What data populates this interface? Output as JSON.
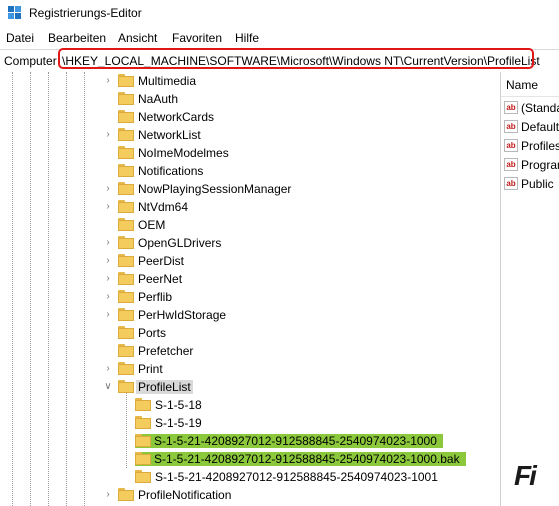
{
  "window": {
    "title": "Registrierungs-Editor",
    "icon": "registry-editor-icon"
  },
  "menu": [
    "Datei",
    "Bearbeiten",
    "Ansicht",
    "Favoriten",
    "Hilfe"
  ],
  "address": {
    "computer": "Computer",
    "path": "\\HKEY_LOCAL_MACHINE\\SOFTWARE\\Microsoft\\Windows NT\\CurrentVersion\\ProfileList",
    "highlight_color": "#e01818"
  },
  "tree": {
    "items": [
      {
        "label": "Multimedia",
        "expander": "collapsed"
      },
      {
        "label": "NaAuth",
        "expander": "none"
      },
      {
        "label": "NetworkCards",
        "expander": "none"
      },
      {
        "label": "NetworkList",
        "expander": "collapsed"
      },
      {
        "label": "NoImeModelmes",
        "expander": "none"
      },
      {
        "label": "Notifications",
        "expander": "none"
      },
      {
        "label": "NowPlayingSessionManager",
        "expander": "collapsed"
      },
      {
        "label": "NtVdm64",
        "expander": "collapsed"
      },
      {
        "label": "OEM",
        "expander": "none"
      },
      {
        "label": "OpenGLDrivers",
        "expander": "collapsed"
      },
      {
        "label": "PeerDist",
        "expander": "collapsed"
      },
      {
        "label": "PeerNet",
        "expander": "collapsed"
      },
      {
        "label": "Perflib",
        "expander": "collapsed"
      },
      {
        "label": "PerHwIdStorage",
        "expander": "collapsed"
      },
      {
        "label": "Ports",
        "expander": "none"
      },
      {
        "label": "Prefetcher",
        "expander": "none"
      },
      {
        "label": "Print",
        "expander": "collapsed"
      },
      {
        "label": "ProfileList",
        "expander": "expanded",
        "selected": true
      },
      {
        "label": "S-1-5-18",
        "child": true
      },
      {
        "label": "S-1-5-19",
        "child": true
      },
      {
        "label": "S-1-5-21-4208927012-912588845-2540974023-1000",
        "child": true,
        "highlight": true
      },
      {
        "label": "S-1-5-21-4208927012-912588845-2540974023-1000.bak",
        "child": true,
        "highlight": true
      },
      {
        "label": "S-1-5-21-4208927012-912588845-2540974023-1001",
        "child": true
      },
      {
        "label": "ProfileNotification",
        "expander": "collapsed"
      }
    ],
    "selected_bg": "#d9d9d9",
    "highlight_bg": "#8bc83c"
  },
  "values": {
    "column_name": "Name",
    "items": [
      {
        "label": "(Standard)",
        "icon": "string-value-icon"
      },
      {
        "label": "Default",
        "icon": "string-value-icon"
      },
      {
        "label": "ProfilesDirectory",
        "icon": "string-value-icon"
      },
      {
        "label": "ProgramData",
        "icon": "string-value-icon"
      },
      {
        "label": "Public",
        "icon": "string-value-icon"
      }
    ]
  },
  "watermark": {
    "text": "Fi"
  }
}
